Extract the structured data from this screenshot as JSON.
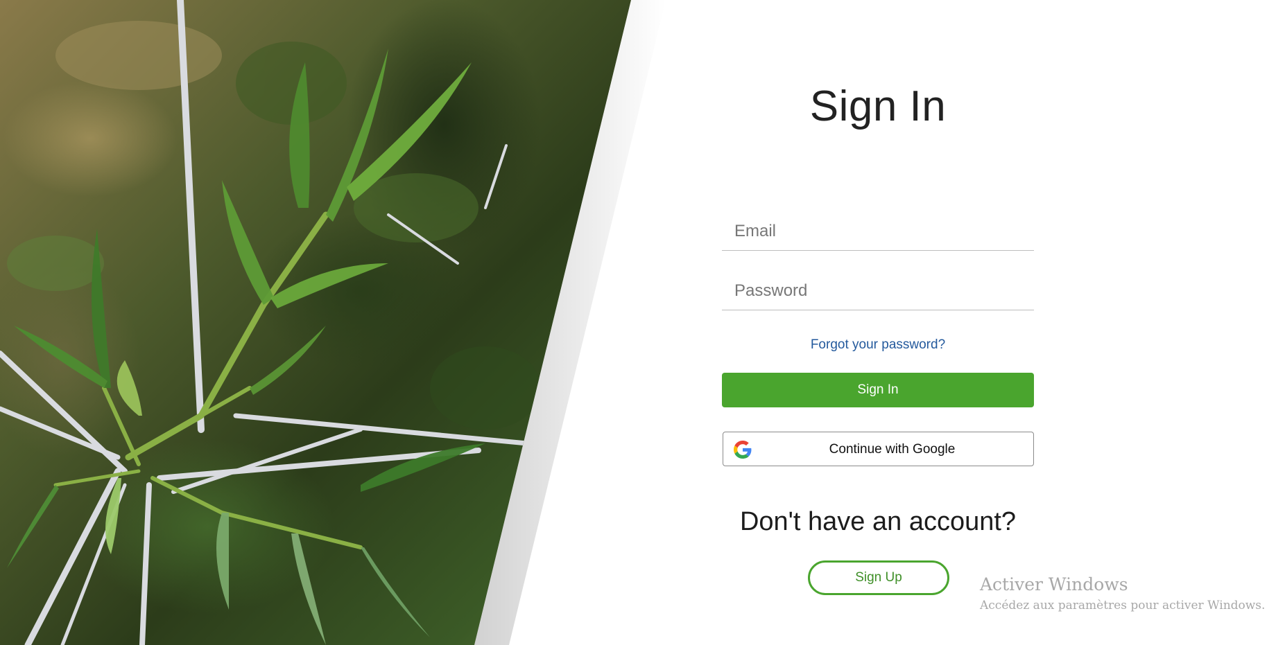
{
  "form": {
    "title": "Sign In",
    "email_placeholder": "Email",
    "password_placeholder": "Password",
    "forgot_label": "Forgot your password?",
    "signin_label": "Sign In",
    "google_label": "Continue with Google",
    "no_account_text": "Don't have an account?",
    "signup_label": "Sign Up"
  },
  "watermark": {
    "title": "Activer Windows",
    "subtitle": "Accédez aux paramètres pour activer Windows."
  },
  "hero_image": {
    "subject": "green fern-like leaves",
    "icon": "nature-photo"
  },
  "colors": {
    "primary_green": "#4aa52e",
    "link_blue": "#23599c",
    "text_dark": "#222222"
  },
  "icons": {
    "google": "google-g-icon"
  }
}
